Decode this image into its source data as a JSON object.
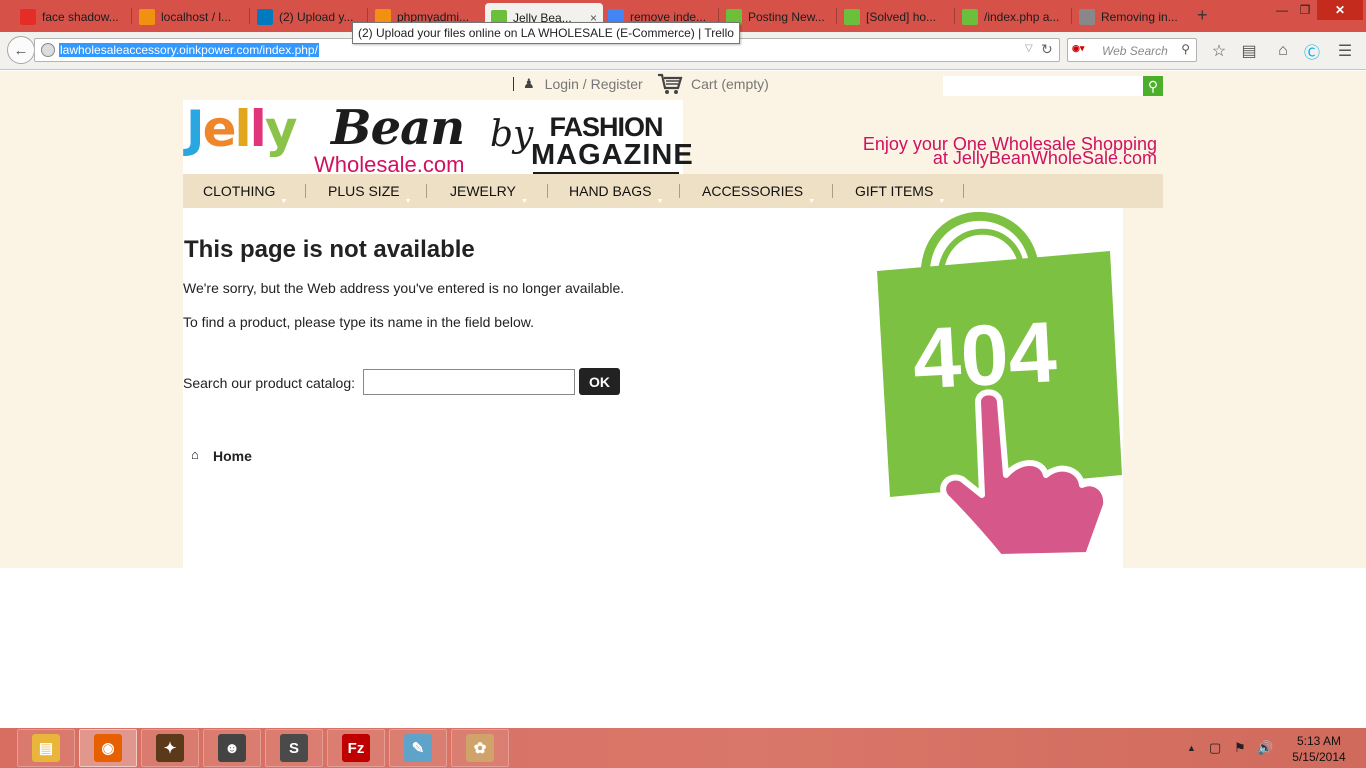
{
  "browser": {
    "tabs": [
      {
        "label": "face shadow...",
        "icon": "youtube-icon",
        "color": "#e52d27",
        "active": false
      },
      {
        "label": "localhost / l...",
        "icon": "phpmyadmin-icon",
        "color": "#f29111",
        "active": false
      },
      {
        "label": "(2) Upload y...",
        "icon": "trello-icon",
        "color": "#0079bf",
        "active": false
      },
      {
        "label": "phpmyadmi...",
        "icon": "phpmyadmin-icon",
        "color": "#f29111",
        "active": false
      },
      {
        "label": "Jelly Bea...",
        "icon": "jellybean-icon",
        "color": "#6cbf3a",
        "active": true
      },
      {
        "label": "remove inde...",
        "icon": "google-icon",
        "color": "#4285f4",
        "active": false
      },
      {
        "label": "Posting New...",
        "icon": "oinkpower-icon",
        "color": "#6cbf3a",
        "active": false
      },
      {
        "label": "[Solved] ho...",
        "icon": "oinkpower-icon",
        "color": "#6cbf3a",
        "active": false
      },
      {
        "label": "/index.php a...",
        "icon": "oinkpower-icon",
        "color": "#6cbf3a",
        "active": false
      },
      {
        "label": "Removing in...",
        "icon": "page-icon",
        "color": "#888888",
        "active": false
      }
    ],
    "tab_close": "×",
    "new_tab": "+",
    "tooltip": "(2) Upload your files online on LA WHOLESALE (E-Commerce) | Trello",
    "url": "lawholesaleaccessory.oinkpower.com/index.php/",
    "search_placeholder": "Web Search",
    "window_buttons": {
      "minimize": "—",
      "maximize": "❐",
      "close": "✕"
    }
  },
  "site": {
    "topbar": {
      "login": "Login / Register",
      "cart": "Cart (empty)"
    },
    "logo": {
      "jelly_letters": [
        "J",
        "e",
        "l",
        "l",
        "y"
      ],
      "jelly_colors": [
        "#2aa6e0",
        "#f0862a",
        "#e3a51c",
        "#e0357a",
        "#8bc34a"
      ],
      "bean": "Bean",
      "wholesale": "Wholesale.com",
      "by": "by",
      "fashion": "FASHION",
      "magazine": "MAGAZINE"
    },
    "tagline": {
      "line1": "Enjoy your One Wholesale Shopping",
      "line2": "at JellyBeanWholeSale.com"
    },
    "menu": [
      "CLOTHING",
      "PLUS SIZE",
      "JEWELRY",
      "HAND BAGS",
      "ACCESSORIES",
      "GIFT ITEMS"
    ],
    "error": {
      "title": "This page is not available",
      "msg1": "We're sorry, but the Web address you've entered is no longer available.",
      "msg2": "To find a product, please type its name in the field below.",
      "search_label": "Search our product catalog:",
      "ok": "OK",
      "home": "Home",
      "image_text": "404"
    },
    "colors": {
      "accent_pink": "#d0115f",
      "bag_green": "#7dc142",
      "hand_pink": "#d6578a",
      "menu_bg": "#ede0c4",
      "page_bg": "#fbf3e3"
    }
  },
  "taskbar": {
    "apps": [
      {
        "name": "file-explorer",
        "glyph": "▤",
        "color": "#e9b53b",
        "active": false
      },
      {
        "name": "firefox",
        "glyph": "◉",
        "color": "#e66000",
        "active": true
      },
      {
        "name": "game-app",
        "glyph": "✦",
        "color": "#5a3a1a",
        "active": false
      },
      {
        "name": "anime-app",
        "glyph": "☻",
        "color": "#444444",
        "active": false
      },
      {
        "name": "sublime-text",
        "glyph": "S",
        "color": "#4a4a4a",
        "active": false
      },
      {
        "name": "filezilla",
        "glyph": "Fz",
        "color": "#bf0000",
        "active": false
      },
      {
        "name": "notepad",
        "glyph": "✎",
        "color": "#5fa3c8",
        "active": false
      },
      {
        "name": "paint",
        "glyph": "✿",
        "color": "#cfa36a",
        "active": false
      }
    ],
    "time": "5:13 AM",
    "date": "5/15/2014"
  }
}
